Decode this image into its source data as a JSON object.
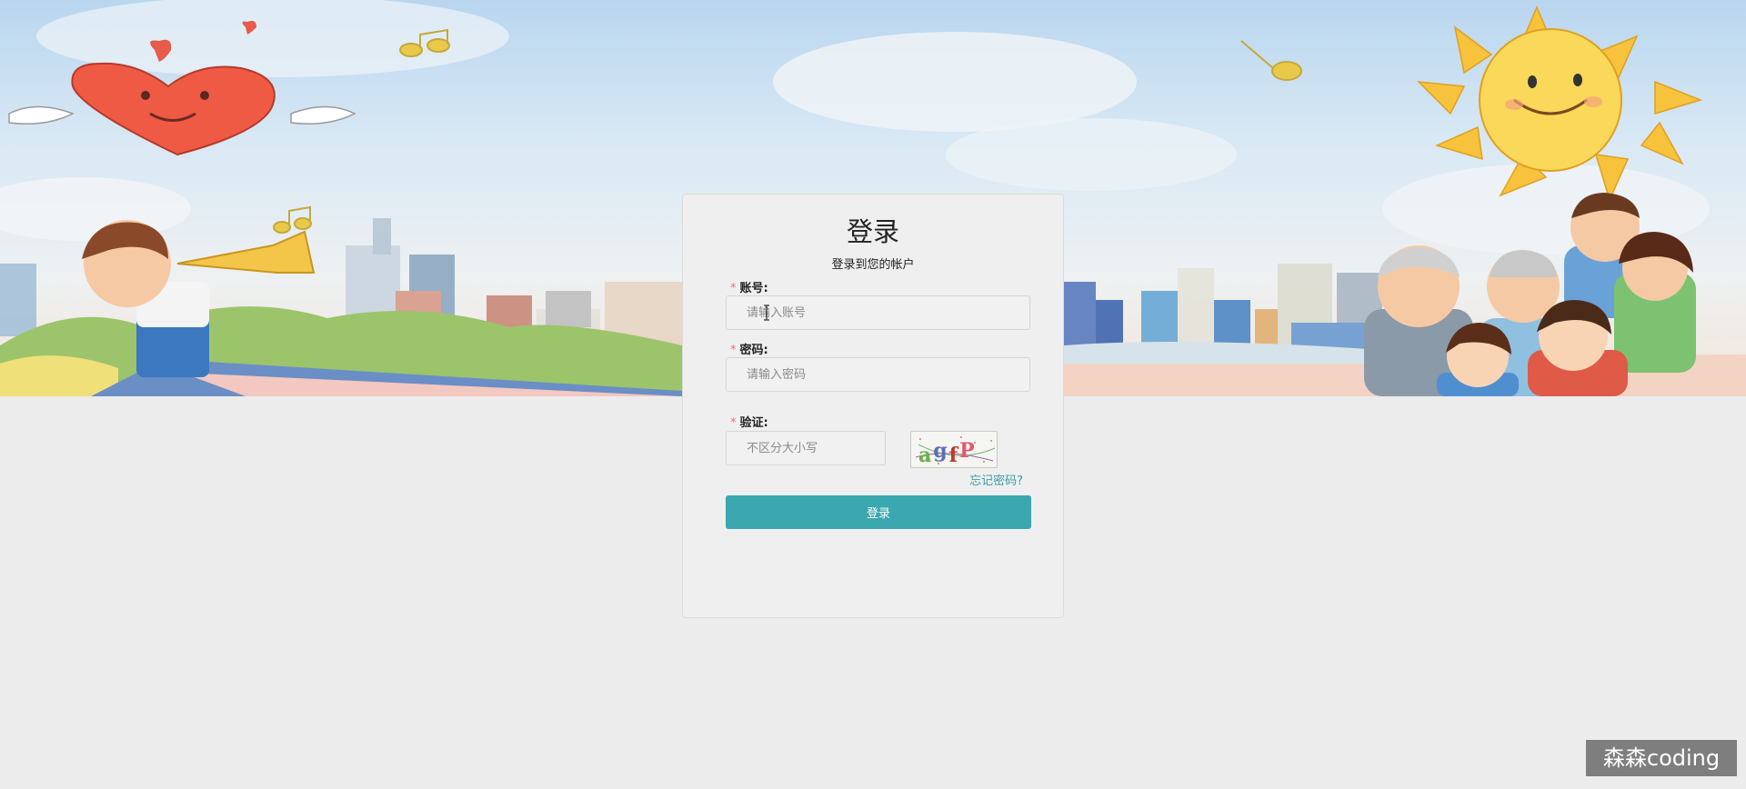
{
  "login": {
    "title": "登录",
    "subtitle": "登录到您的帐户",
    "account": {
      "required_mark": "*",
      "label": "账号:",
      "placeholder": "请输入账号",
      "value": ""
    },
    "password": {
      "required_mark": "*",
      "label": "密码:",
      "placeholder": "请输入密码",
      "value": ""
    },
    "captcha": {
      "required_mark": "*",
      "label": "验证:",
      "placeholder": "不区分大小写",
      "value": "",
      "image_text": "agfP"
    },
    "forgot_link": "忘记密码?",
    "submit_label": "登录"
  },
  "watermark": "森森coding",
  "colors": {
    "accent": "#3ba7ae",
    "required": "#f56c6c",
    "page_background": "#ececec"
  },
  "icons": [
    "text-cursor-icon",
    "heart-illustration",
    "sun-illustration",
    "music-note-icon"
  ]
}
